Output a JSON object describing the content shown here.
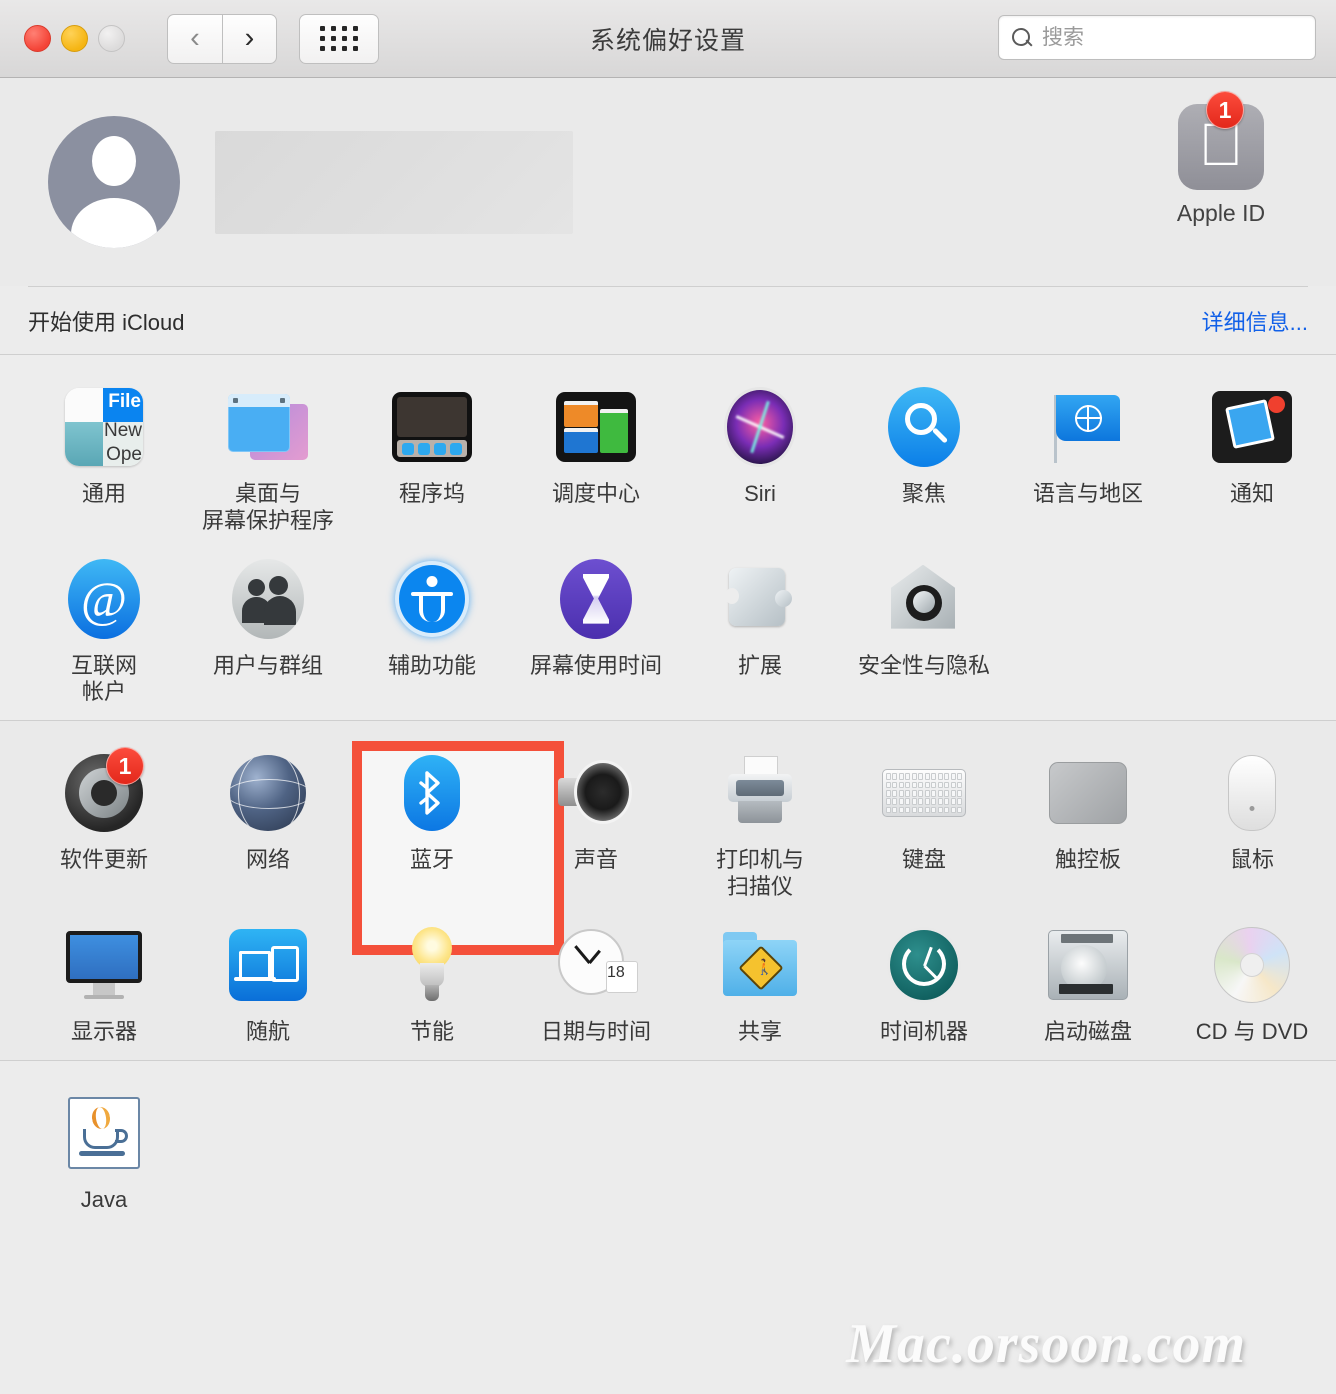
{
  "window": {
    "title": "系统偏好设置",
    "traffic_lights": [
      "close",
      "minimize",
      "zoom-disabled"
    ],
    "nav": {
      "back": "‹",
      "forward": "›",
      "grid": "grid-view"
    },
    "search": {
      "placeholder": "搜索",
      "value": ""
    }
  },
  "account": {
    "name_redacted": "",
    "apple_id_label": "Apple ID",
    "apple_id_badge": "1"
  },
  "icloud": {
    "label": "开始使用 iCloud",
    "link": "详细信息..."
  },
  "highlight": {
    "target": "蓝牙",
    "color": "#f4503a"
  },
  "sections": [
    {
      "name": "personal",
      "items": [
        {
          "label": "通用",
          "icon": "general-icon"
        },
        {
          "label": "桌面与\n屏幕保护程序",
          "icon": "desktop-screensaver-icon"
        },
        {
          "label": "程序坞",
          "icon": "dock-icon"
        },
        {
          "label": "调度中心",
          "icon": "mission-control-icon"
        },
        {
          "label": "Siri",
          "icon": "siri-icon"
        },
        {
          "label": "聚焦",
          "icon": "spotlight-icon"
        },
        {
          "label": "语言与地区",
          "icon": "language-region-icon"
        },
        {
          "label": "通知",
          "icon": "notifications-icon"
        },
        {
          "label": "互联网\n帐户",
          "icon": "internet-accounts-icon"
        },
        {
          "label": "用户与群组",
          "icon": "users-groups-icon"
        },
        {
          "label": "辅助功能",
          "icon": "accessibility-icon"
        },
        {
          "label": "屏幕使用时间",
          "icon": "screen-time-icon"
        },
        {
          "label": "扩展",
          "icon": "extensions-icon"
        },
        {
          "label": "安全性与隐私",
          "icon": "security-privacy-icon"
        }
      ]
    },
    {
      "name": "hardware",
      "items": [
        {
          "label": "软件更新",
          "icon": "software-update-icon",
          "badge": "1"
        },
        {
          "label": "网络",
          "icon": "network-icon"
        },
        {
          "label": "蓝牙",
          "icon": "bluetooth-icon",
          "highlighted": true
        },
        {
          "label": "声音",
          "icon": "sound-icon"
        },
        {
          "label": "打印机与\n扫描仪",
          "icon": "printers-scanners-icon"
        },
        {
          "label": "键盘",
          "icon": "keyboard-icon"
        },
        {
          "label": "触控板",
          "icon": "trackpad-icon"
        },
        {
          "label": "鼠标",
          "icon": "mouse-icon"
        },
        {
          "label": "显示器",
          "icon": "displays-icon"
        },
        {
          "label": "随航",
          "icon": "sidecar-icon"
        },
        {
          "label": "节能",
          "icon": "energy-saver-icon"
        },
        {
          "label": "日期与时间",
          "icon": "date-time-icon",
          "day": "18"
        },
        {
          "label": "共享",
          "icon": "sharing-icon"
        },
        {
          "label": "时间机器",
          "icon": "time-machine-icon"
        },
        {
          "label": "启动磁盘",
          "icon": "startup-disk-icon"
        },
        {
          "label": "CD 与 DVD",
          "icon": "cd-dvd-icon"
        }
      ]
    },
    {
      "name": "other",
      "items": [
        {
          "label": "Java",
          "icon": "java-icon"
        }
      ]
    }
  ],
  "watermark": "Mac.orsoon.com"
}
